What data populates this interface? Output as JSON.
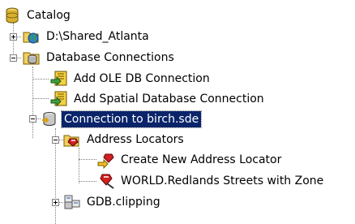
{
  "tree": {
    "root": {
      "label": "Catalog",
      "icon": "catalog-icon"
    },
    "items": [
      {
        "label": "D:\\Shared_Atlanta",
        "icon": "folder-globe-icon",
        "expanded": false
      },
      {
        "label": "Database Connections",
        "icon": "database-connections-folder-icon",
        "expanded": true
      },
      {
        "label": "Add OLE DB Connection",
        "icon": "add-connection-icon"
      },
      {
        "label": "Add Spatial Database Connection",
        "icon": "add-connection-icon"
      },
      {
        "label": "Connection to birch.sde",
        "icon": "sde-connection-icon",
        "expanded": true,
        "selected": true
      },
      {
        "label": "Address Locators",
        "icon": "address-locators-icon",
        "expanded": true
      },
      {
        "label": "Create New Address Locator",
        "icon": "create-locator-icon"
      },
      {
        "label": "WORLD.Redlands Streets with Zone",
        "icon": "address-locator-icon"
      },
      {
        "label": "GDB.clipping",
        "icon": "feature-dataset-icon",
        "expanded": false
      }
    ]
  },
  "colors": {
    "selection": "#0a246a",
    "tree_lines": "#808080"
  }
}
